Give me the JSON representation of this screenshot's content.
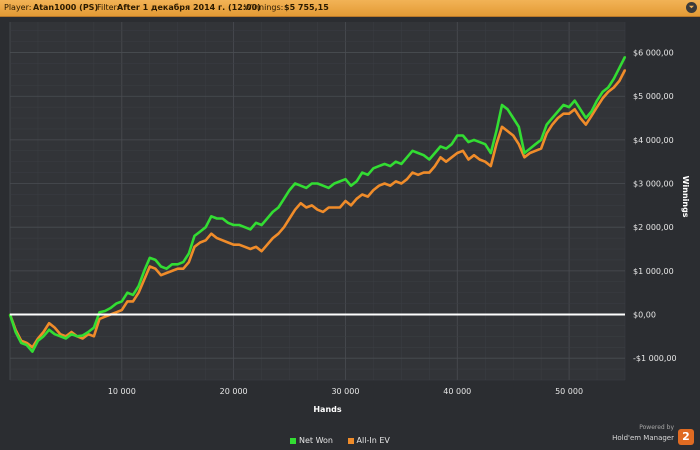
{
  "header": {
    "player_label": "Player:",
    "player_value": "Atan1000 (PS)",
    "filter_label": "Filter:",
    "filter_value": "After 1 декабря 2014 г. (12:00)",
    "winnings_label": "Winnings:",
    "winnings_value": "$5 755,15",
    "toggle_icon": "⏷"
  },
  "colors": {
    "background": "#2b2d31",
    "plot_bg": "#323438",
    "header": "#efa948",
    "net_won": "#33dd33",
    "all_in_ev": "#f08c2a",
    "zero_line": "#ffffff"
  },
  "legend": {
    "net_won": "Net Won",
    "all_in_ev": "All-In EV"
  },
  "brand": {
    "powered": "Powered by",
    "name": "Hold'em Manager",
    "logo_digit": "2"
  },
  "chart_data": {
    "type": "line",
    "xlabel": "Hands",
    "ylabel": "Winnings",
    "xlim": [
      0,
      55000
    ],
    "ylim": [
      -1500,
      6700
    ],
    "x_ticks": [
      10000,
      20000,
      30000,
      40000,
      50000
    ],
    "x_tick_labels": [
      "10 000",
      "20 000",
      "30 000",
      "40 000",
      "50 000"
    ],
    "y_ticks": [
      -1000,
      0,
      1000,
      2000,
      3000,
      4000,
      5000,
      6000
    ],
    "y_tick_labels": [
      "-$1 000,00",
      "$0,00",
      "$1 000,00",
      "$2 000,00",
      "$3 000,00",
      "$4 000,00",
      "$5 000,00",
      "$6 000,00"
    ],
    "grid": true,
    "legend_position": "bottom-center",
    "x": [
      0,
      500,
      1000,
      1500,
      2000,
      2500,
      3000,
      3500,
      4000,
      4500,
      5000,
      5500,
      6000,
      6500,
      7000,
      7500,
      8000,
      8500,
      9000,
      9500,
      10000,
      10500,
      11000,
      11500,
      12000,
      12500,
      13000,
      13500,
      14000,
      14500,
      15000,
      15500,
      16000,
      16500,
      17000,
      17500,
      18000,
      18500,
      19000,
      19500,
      20000,
      20500,
      21000,
      21500,
      22000,
      22500,
      23000,
      23500,
      24000,
      24500,
      25000,
      25500,
      26000,
      26500,
      27000,
      27500,
      28000,
      28500,
      29000,
      29500,
      30000,
      30500,
      31000,
      31500,
      32000,
      32500,
      33000,
      33500,
      34000,
      34500,
      35000,
      35500,
      36000,
      36500,
      37000,
      37500,
      38000,
      38500,
      39000,
      39500,
      40000,
      40500,
      41000,
      41500,
      42000,
      42500,
      43000,
      43500,
      44000,
      44500,
      45000,
      45500,
      46000,
      46500,
      47000,
      47500,
      48000,
      48500,
      49000,
      49500,
      50000,
      50500,
      51000,
      51500,
      52000,
      52500,
      53000,
      53500,
      54000,
      54500,
      55000
    ],
    "series": [
      {
        "name": "Net Won",
        "values": [
          0,
          -400,
          -650,
          -700,
          -850,
          -600,
          -500,
          -350,
          -450,
          -500,
          -550,
          -450,
          -500,
          -480,
          -400,
          -300,
          50,
          80,
          150,
          250,
          300,
          500,
          450,
          650,
          1000,
          1300,
          1250,
          1100,
          1050,
          1150,
          1150,
          1200,
          1400,
          1800,
          1900,
          2000,
          2250,
          2200,
          2200,
          2100,
          2050,
          2050,
          2000,
          1950,
          2100,
          2050,
          2200,
          2350,
          2450,
          2650,
          2850,
          3000,
          2950,
          2900,
          3000,
          3000,
          2950,
          2900,
          3000,
          3050,
          3100,
          2950,
          3050,
          3250,
          3200,
          3350,
          3400,
          3450,
          3400,
          3500,
          3450,
          3600,
          3750,
          3700,
          3650,
          3550,
          3700,
          3850,
          3800,
          3900,
          4100,
          4100,
          3950,
          4000,
          3950,
          3900,
          3700,
          4200,
          4800,
          4700,
          4500,
          4300,
          3700,
          3800,
          3900,
          4000,
          4350,
          4500,
          4650,
          4800,
          4750,
          4900,
          4700,
          4500,
          4650,
          4900,
          5100,
          5200,
          5400,
          5650,
          5900
        ]
      },
      {
        "name": "All-In EV",
        "values": [
          0,
          -350,
          -600,
          -650,
          -750,
          -550,
          -400,
          -200,
          -300,
          -450,
          -500,
          -400,
          -500,
          -550,
          -450,
          -500,
          -100,
          -50,
          0,
          50,
          100,
          300,
          300,
          500,
          800,
          1100,
          1050,
          900,
          950,
          1000,
          1050,
          1050,
          1200,
          1550,
          1650,
          1700,
          1850,
          1750,
          1700,
          1650,
          1600,
          1600,
          1550,
          1500,
          1550,
          1450,
          1600,
          1750,
          1850,
          2000,
          2200,
          2400,
          2550,
          2450,
          2500,
          2400,
          2350,
          2450,
          2450,
          2450,
          2600,
          2500,
          2650,
          2750,
          2700,
          2850,
          2950,
          3000,
          2950,
          3050,
          3000,
          3100,
          3250,
          3200,
          3250,
          3250,
          3400,
          3600,
          3500,
          3600,
          3700,
          3750,
          3550,
          3650,
          3550,
          3500,
          3400,
          3900,
          4300,
          4200,
          4100,
          3900,
          3600,
          3700,
          3750,
          3800,
          4150,
          4350,
          4500,
          4600,
          4600,
          4700,
          4500,
          4350,
          4550,
          4750,
          4950,
          5100,
          5200,
          5350,
          5600
        ]
      }
    ]
  }
}
